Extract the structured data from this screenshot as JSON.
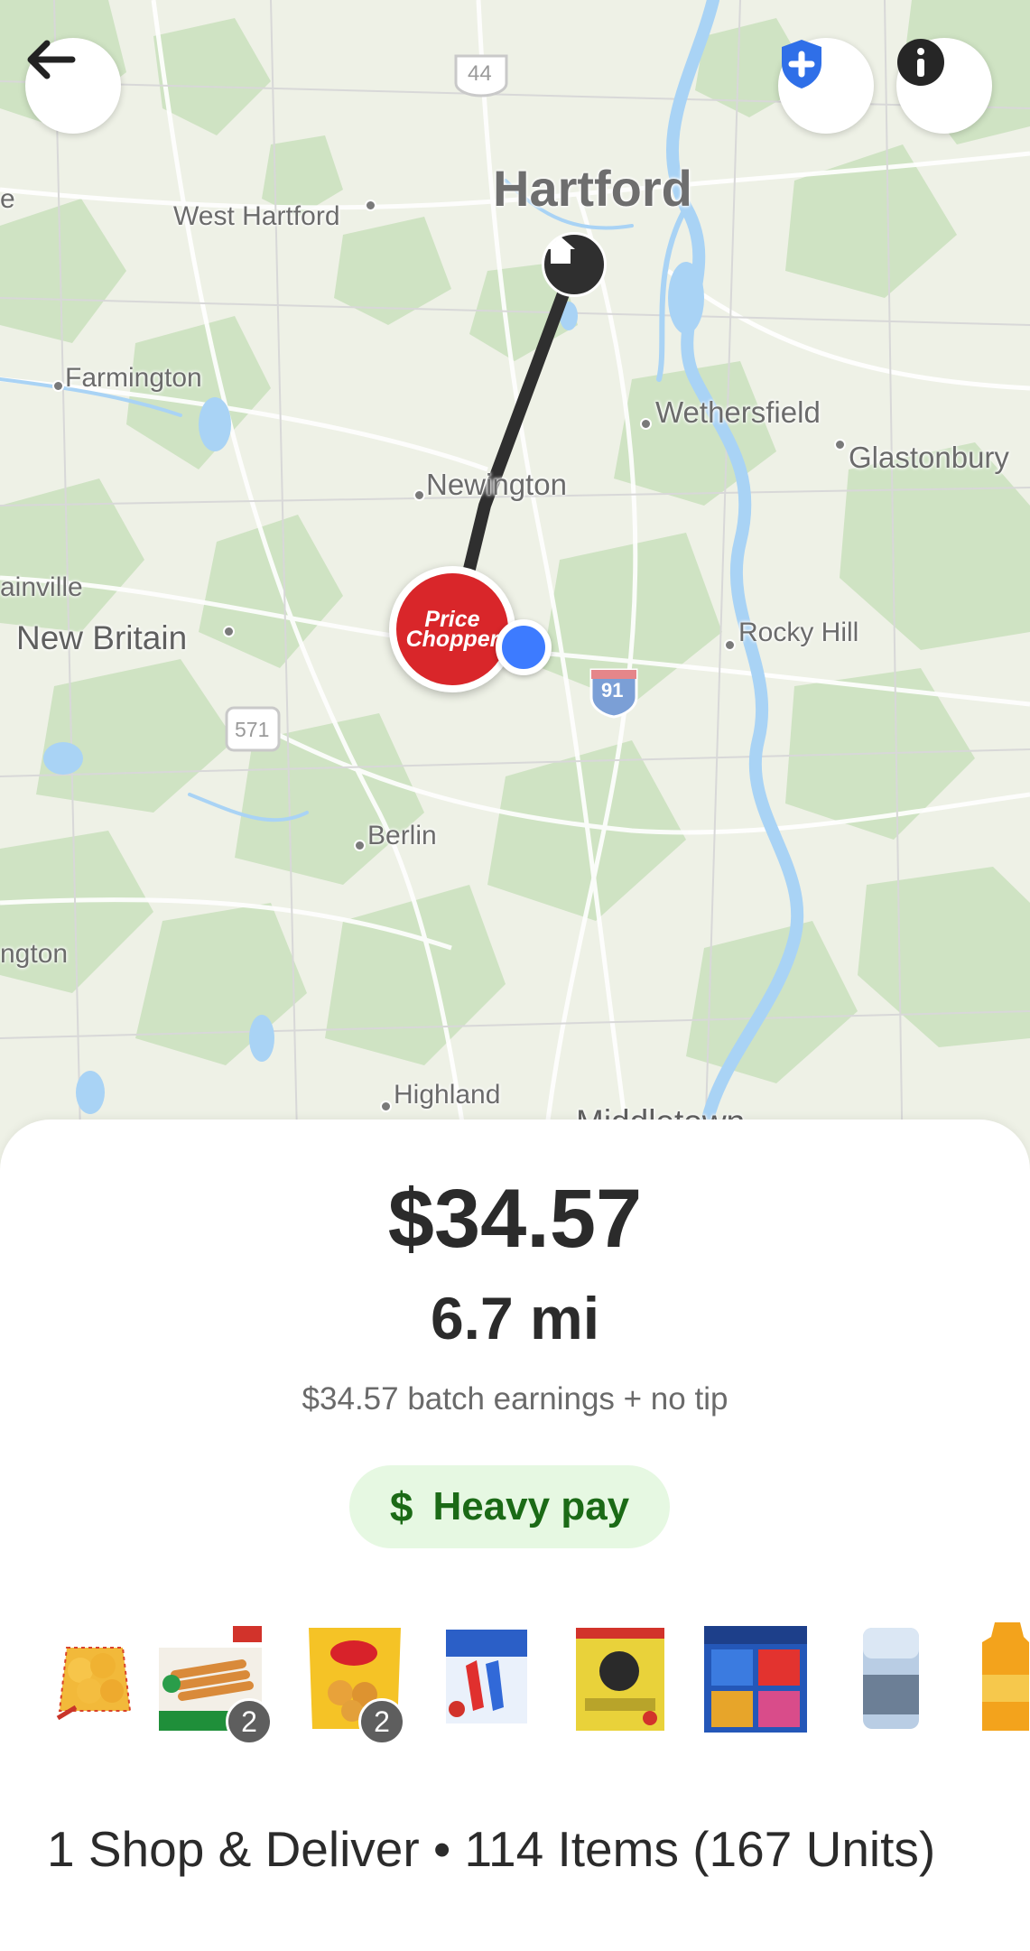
{
  "map": {
    "places": {
      "hartford": "Hartford",
      "west_hartford": "West Hartford",
      "farmington": "Farmington",
      "wethersfield": "Wethersfield",
      "glastonbury": "Glastonbury",
      "newington": "Newington",
      "plainville_partial": "ainville",
      "new_britain": "New Britain",
      "rocky_hill": "Rocky Hill",
      "berlin": "Berlin",
      "southington_partial": "ngton",
      "highland": "Highland",
      "middletown_partial": "Middletown",
      "edge_partial": "e"
    },
    "routes": {
      "us44": "44",
      "i91": "91",
      "rt571": "571"
    },
    "store": {
      "name_line1": "Price",
      "name_line2": "Chopper"
    }
  },
  "colors": {
    "map_bg": "#eef1e6",
    "forest": "#cfe3c3",
    "water": "#a9d3f5",
    "route": "#2f2f2f",
    "store_red": "#d9262a",
    "location_blue": "#3d7bff",
    "safety_blue": "#2f6fe8",
    "pay_green_bg": "#e6f8e2",
    "pay_green_text": "#1b6a16"
  },
  "icons": {
    "back": "arrow-left-icon",
    "safety": "shield-plus-icon",
    "info": "info-icon",
    "home": "home-icon",
    "dollar": "dollar-icon"
  },
  "offer": {
    "price": "$34.57",
    "distance": "6.7 mi",
    "earnings_note": "$34.57 batch earnings + no tip",
    "pay_badge": "Heavy pay",
    "pay_badge_symbol": "$",
    "summary": "1 Shop & Deliver • 114 Items (167 Units)"
  },
  "items": [
    {
      "name": "oranges-bag",
      "qty": ""
    },
    {
      "name": "farmrich-mozzarella-sticks",
      "qty": "2"
    },
    {
      "name": "totinos-pizza-rolls",
      "qty": "2"
    },
    {
      "name": "bomb-pop-popsicles",
      "qty": ""
    },
    {
      "name": "4c-lemonade-mix",
      "qty": ""
    },
    {
      "name": "nabisco-20-packs",
      "qty": ""
    },
    {
      "name": "salt-canister",
      "qty": ""
    },
    {
      "name": "orange-juice-jug",
      "qty": ""
    }
  ]
}
